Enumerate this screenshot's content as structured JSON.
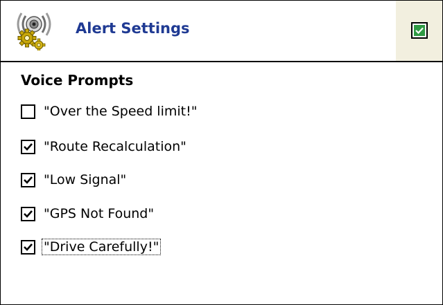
{
  "header": {
    "title": "Alert Settings",
    "icon": "speaker-gears-icon",
    "ok_icon": "ok-check-icon"
  },
  "section": {
    "title": "Voice Prompts"
  },
  "options": [
    {
      "label": "\"Over the Speed limit!\"",
      "checked": false
    },
    {
      "label": "\"Route Recalculation\"",
      "checked": true
    },
    {
      "label": "\"Low Signal\"",
      "checked": true
    },
    {
      "label": "\"GPS Not Found\"",
      "checked": true
    },
    {
      "label": "\"Drive Carefully!\"",
      "checked": true,
      "focused": true
    }
  ],
  "colors": {
    "title": "#1f3a93",
    "ok_button": "#2f9a43",
    "ok_area": "#f2efdf"
  }
}
